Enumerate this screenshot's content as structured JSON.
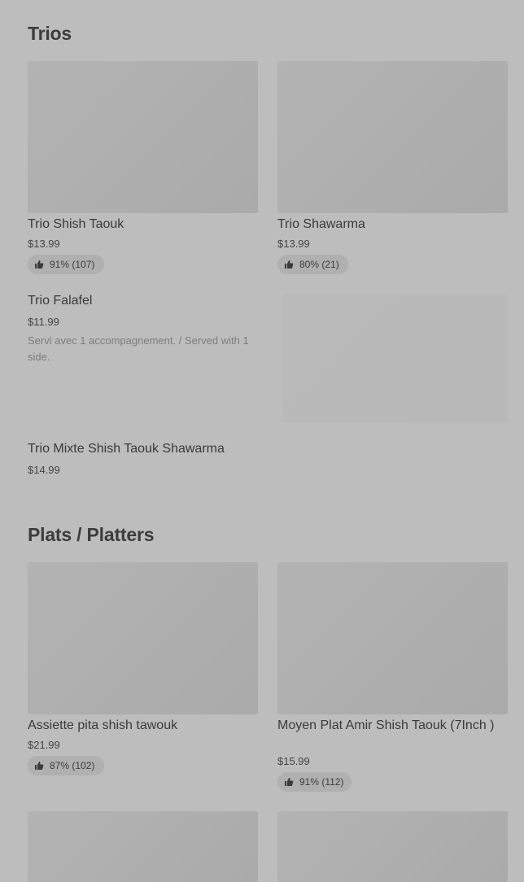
{
  "sections": [
    {
      "title": "Trios",
      "items": [
        {
          "name": "Trio Shish Taouk",
          "price": "$13.99",
          "rating": "91% (107)"
        },
        {
          "name": "Trio Shawarma",
          "price": "$13.99",
          "rating": "80% (21)"
        },
        {
          "name": "Trio Falafel",
          "price": "$11.99",
          "description": "Servi avec 1 accompagnement. / Served with 1 side."
        },
        {
          "name": "Trio Mixte Shish Taouk Shawarma",
          "price": "$14.99"
        }
      ]
    },
    {
      "title": "Plats / Platters",
      "items": [
        {
          "name": "Assiette pita shish tawouk",
          "price": "$21.99",
          "rating": "87% (102)"
        },
        {
          "name": "Moyen Plat Amir Shish Taouk (7Inch )",
          "price": "$15.99",
          "rating": "91% (112)"
        }
      ]
    }
  ],
  "icons": {
    "rating": "thumbs-up-icon"
  },
  "colors": {
    "background": "#bdbdbd",
    "image_placeholder": "#afafaf",
    "rating_pill": "#b0b0b0"
  }
}
